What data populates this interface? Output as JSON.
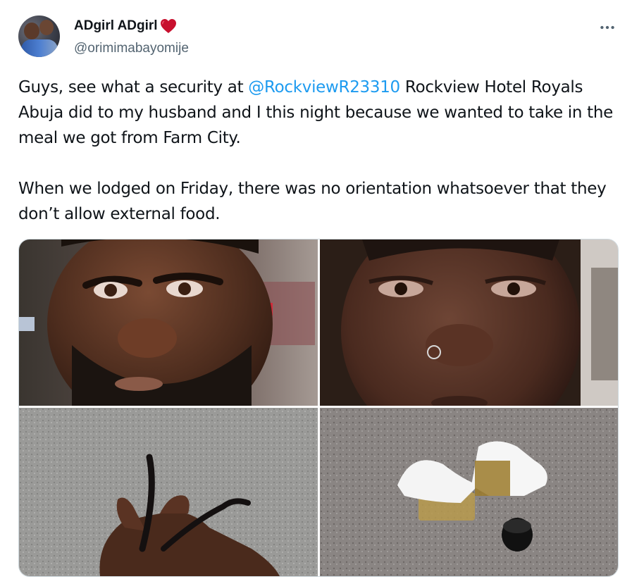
{
  "author": {
    "display_name": "ADgirl ADgirl",
    "handle": "@orimimabayomije",
    "heart_icon": "red-heart-emoji",
    "heart_color": "#c8102e"
  },
  "actions": {
    "more_icon": "more-horizontal-icon"
  },
  "tweet": {
    "line1_before_mention": "Guys, see what a security at ",
    "mention": "@RockviewR23310",
    "line1_after_mention": " Rockview Hotel Royals Abuja did to my husband and I this night because we wanted to take in the meal we got from Farm City.",
    "paragraph2": "When we lodged on Friday, there was no orientation whatsoever that they don’t allow external food."
  },
  "media": {
    "photos": [
      {
        "subject": "man-face-photo"
      },
      {
        "subject": "woman-face-photo"
      },
      {
        "subject": "hand-holding-dreadlocks-photo"
      },
      {
        "subject": "food-packs-on-floor-photo"
      }
    ]
  },
  "colors": {
    "text": "#0f1419",
    "secondary": "#536471",
    "link": "#1d9bf0",
    "border": "#cfd9de"
  }
}
